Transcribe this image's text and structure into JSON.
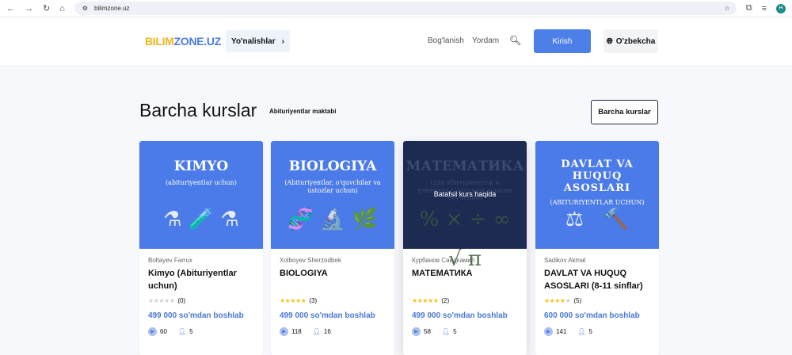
{
  "browser": {
    "url": "bilimzone.uz",
    "avatar": "H"
  },
  "nav": {
    "logo_a": "BILIM",
    "logo_b": "ZONE.UZ",
    "directions": "Yo'nalishlar",
    "contact": "Bog'lanish",
    "help": "Yordam",
    "login": "Kirish",
    "language": "O'zbekcha"
  },
  "section": {
    "title": "Barcha kurslar",
    "subtitle": "Abituriyentlar maktabi",
    "all_button": "Barcha kurslar"
  },
  "courses": [
    {
      "img_title": "KIMYO",
      "img_sub": "(abituriyentlar uchun)",
      "author": "Boltayev Farrux",
      "name": "Kimyo (Abituriyentlar uchun)",
      "rating": 0,
      "reviews": "(0)",
      "price": "499 000 so'mdan boshlab",
      "lessons": "60",
      "students": "5"
    },
    {
      "img_title": "BIOLOGIYA",
      "img_sub": "(Abituriyentlar, o'quvchilar va ustozlar uchun)",
      "author": "Xolboyev Sherzodbek",
      "name": "BIOLOGIYA",
      "rating": 5,
      "reviews": "(3)",
      "price": "499 000 so'mdan boshlab",
      "lessons": "118",
      "students": "16"
    },
    {
      "img_title": "МАТЕМАТИКА",
      "img_sub": "(для абитуриентов и учеников с русским языком обучения)",
      "overlay": "Batafsil kurs haqida",
      "author": "Курбанов Саидкамил",
      "name": "МАТЕМАТИКА",
      "rating": 5,
      "reviews": "(2)",
      "price": "499 000 so'mdan boshlab",
      "lessons": "58",
      "students": "5"
    },
    {
      "img_title": "DAVLAT VA HUQUQ ASOSLARI",
      "img_sub": "(ABITURIYENTLAR UCHUN)",
      "author": "Sadikov Akmal",
      "name": "DAVLAT VA HUQUQ ASOSLARI (8-11 sinflar)",
      "rating": 4,
      "reviews": "(5)",
      "price": "600 000 so'mdan boshlab",
      "lessons": "141",
      "students": "5"
    }
  ],
  "colors": {
    "accent": "#4c7fe8",
    "star": "#f5c518",
    "star_empty": "#d0d0d0"
  }
}
